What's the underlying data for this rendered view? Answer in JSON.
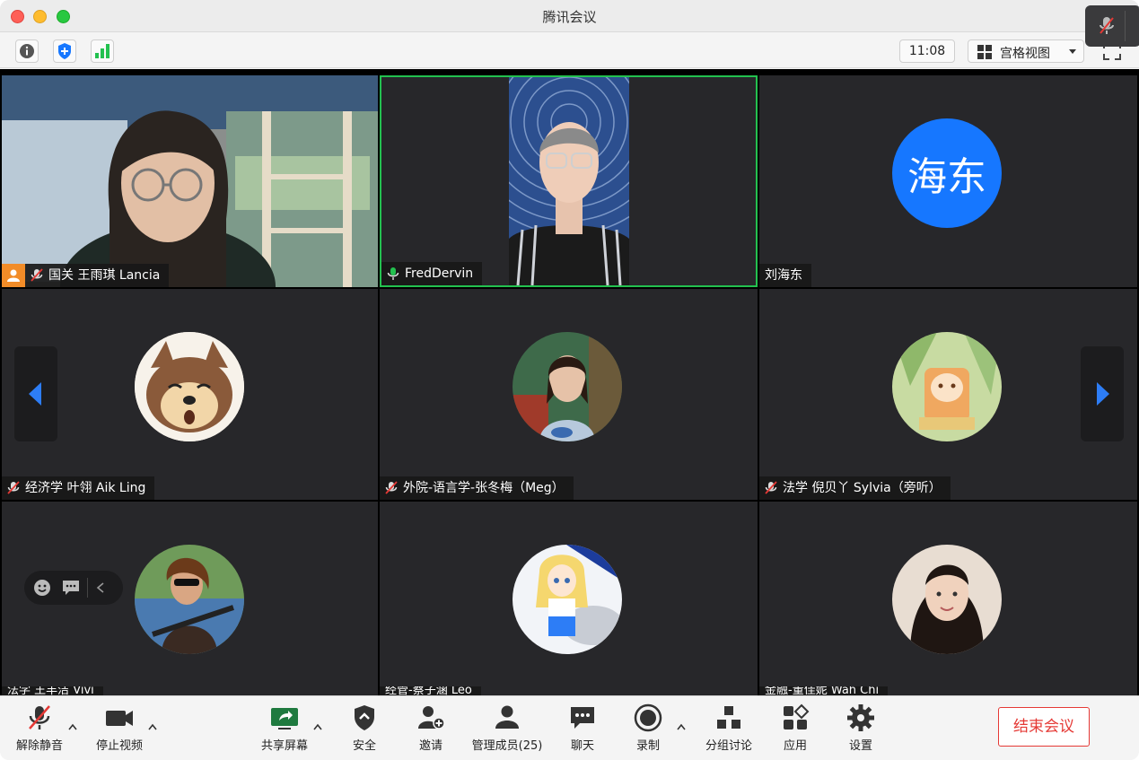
{
  "window": {
    "title": "腾讯会议"
  },
  "infobar": {
    "time": "11:08",
    "view_label": "宫格视图"
  },
  "tiles": [
    {
      "name": "国关 王雨琪 Lancia"
    },
    {
      "name": "FredDervin"
    },
    {
      "name": "刘海东",
      "avatar_text": "海东"
    },
    {
      "name": "经济学 叶翎 Aik Ling"
    },
    {
      "name": "外院-语言学-张冬梅（Meg）"
    },
    {
      "name": "法学 倪贝丫 Sylvia（旁听）"
    },
    {
      "name": "法学 王丰洁 Vivi"
    },
    {
      "name": "经管-蔡子涵 Leo"
    },
    {
      "name": "金融-董佳妮 Wah Chi"
    }
  ],
  "toolbar": {
    "unmute": "解除静音",
    "stop_video": "停止视频",
    "share_screen": "共享屏幕",
    "security": "安全",
    "invite": "邀请",
    "manage_members": "管理成员(25)",
    "chat": "聊天",
    "record": "录制",
    "breakout": "分组讨论",
    "apps": "应用",
    "settings": "设置",
    "end_meeting": "结束会议"
  },
  "colors": {
    "active_speaker": "#23c14f",
    "avatar_blue": "#1677ff",
    "end_red": "#e53935",
    "nav_arrow_blue": "#2d7df6",
    "tile_bg": "#27272a"
  }
}
